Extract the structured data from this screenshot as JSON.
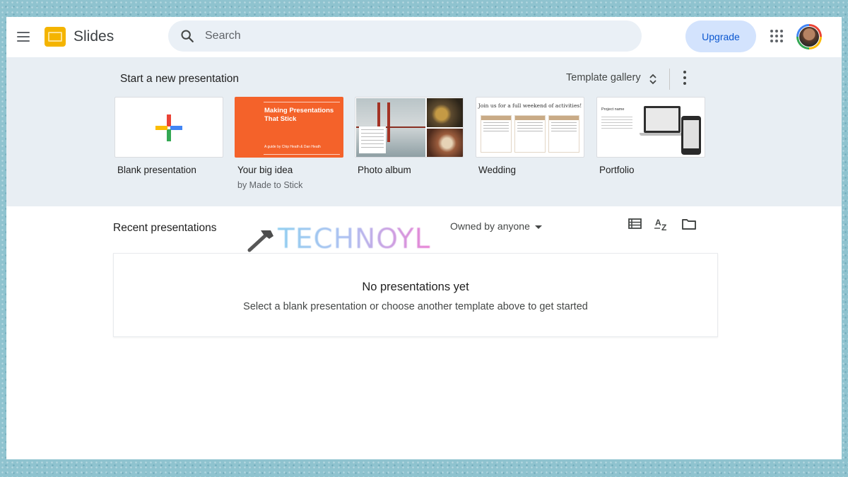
{
  "header": {
    "app_name": "Slides",
    "search_placeholder": "Search",
    "upgrade_label": "Upgrade"
  },
  "templates": {
    "section_title": "Start a new presentation",
    "gallery_label": "Template gallery",
    "items": [
      {
        "name": "Blank presentation",
        "subtitle": ""
      },
      {
        "name": "Your big idea",
        "subtitle": "by Made to Stick",
        "thumb_title": "Making Presentations That Stick",
        "thumb_subtitle": "A guide by Chip Heath & Dan Heath"
      },
      {
        "name": "Photo album",
        "subtitle": ""
      },
      {
        "name": "Wedding",
        "subtitle": "",
        "thumb_title": "Join us for a full weekend of activities!"
      },
      {
        "name": "Portfolio",
        "subtitle": "",
        "thumb_title": "Project name"
      }
    ]
  },
  "recent": {
    "title": "Recent presentations",
    "owner_filter": "Owned by anyone",
    "empty_title": "No presentations yet",
    "empty_subtitle": "Select a blank presentation or choose another template above to get started"
  },
  "watermark": {
    "text": "TECHNOYL"
  },
  "icons": {
    "menu": "menu-icon",
    "logo": "slides-logo-icon",
    "search": "search-icon",
    "apps": "apps-grid-icon",
    "expand": "unfold-icon",
    "more": "more-vert-icon",
    "list_view": "list-view-icon",
    "sort": "sort-az-icon",
    "folder": "folder-icon"
  },
  "colors": {
    "accent_blue": "#0b57d0",
    "upgrade_bg": "#d3e3fd",
    "slides_yellow": "#f4b400",
    "template_bg": "#e8eef3",
    "orange_template": "#f4622a"
  }
}
